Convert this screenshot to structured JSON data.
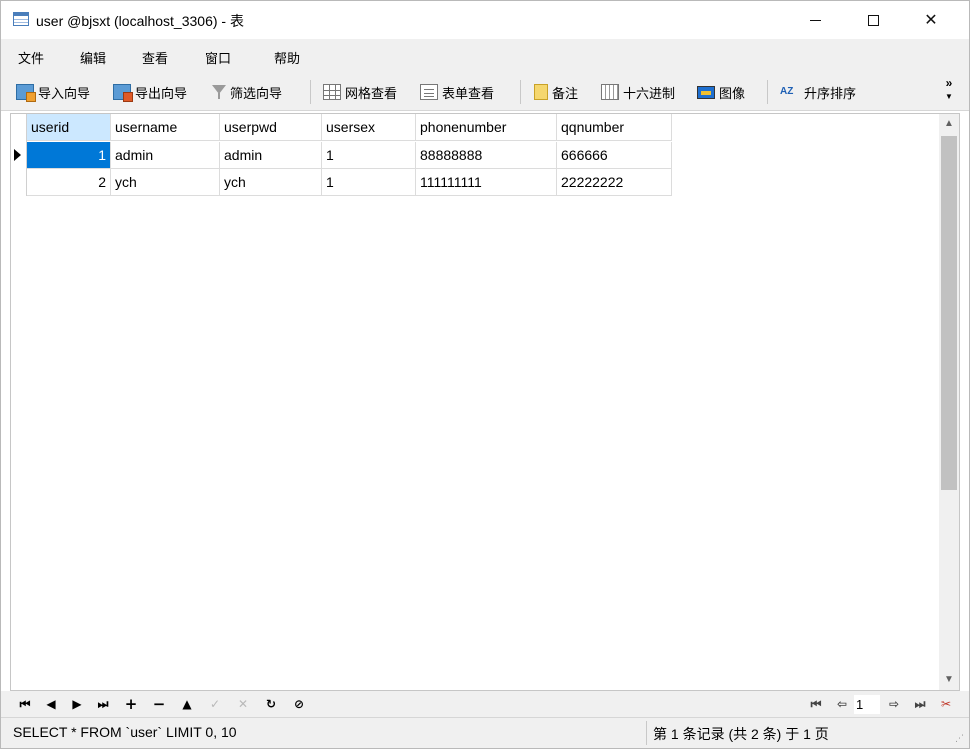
{
  "window": {
    "title": "user @bjsxt (localhost_3306) - 表",
    "controls": {
      "minimize": "─",
      "maximize": "☐",
      "close": "✕"
    }
  },
  "menu": [
    "文件",
    "编辑",
    "查看",
    "窗口",
    "帮助"
  ],
  "toolbar": {
    "import": "导入向导",
    "export": "导出向导",
    "filter": "筛选向导",
    "grid_view": "网格查看",
    "form_view": "表单查看",
    "memo": "备注",
    "hex": "十六进制",
    "image": "图像",
    "sort_asc": "升序排序",
    "sort_icon_text": "AZ",
    "more": "»"
  },
  "table": {
    "columns": [
      "userid",
      "username",
      "userpwd",
      "usersex",
      "phonenumber",
      "qqnumber"
    ],
    "selected_column": "userid",
    "rows": [
      [
        "1",
        "admin",
        "admin",
        "1",
        "88888888",
        "666666"
      ],
      [
        "2",
        "ych",
        "ych",
        "1",
        "111111111",
        "22222222"
      ]
    ],
    "current_row": 0
  },
  "navigation": {
    "first": "⏮",
    "prev": "◀",
    "next": "▶",
    "last": "⏭",
    "add": "+",
    "delete": "−",
    "up": "▲",
    "apply": "✓",
    "cancel": "✕",
    "refresh": "↻",
    "stop": "⊘",
    "page_first": "⏮",
    "page_prev": "⇦",
    "page_value": "1",
    "page_next": "⇨",
    "page_last": "⏭",
    "tools": "✂"
  },
  "status": {
    "sql": "SELECT * FROM `user` LIMIT 0, 10",
    "records": "第 1 条记录 (共 2 条) 于 1 页"
  }
}
